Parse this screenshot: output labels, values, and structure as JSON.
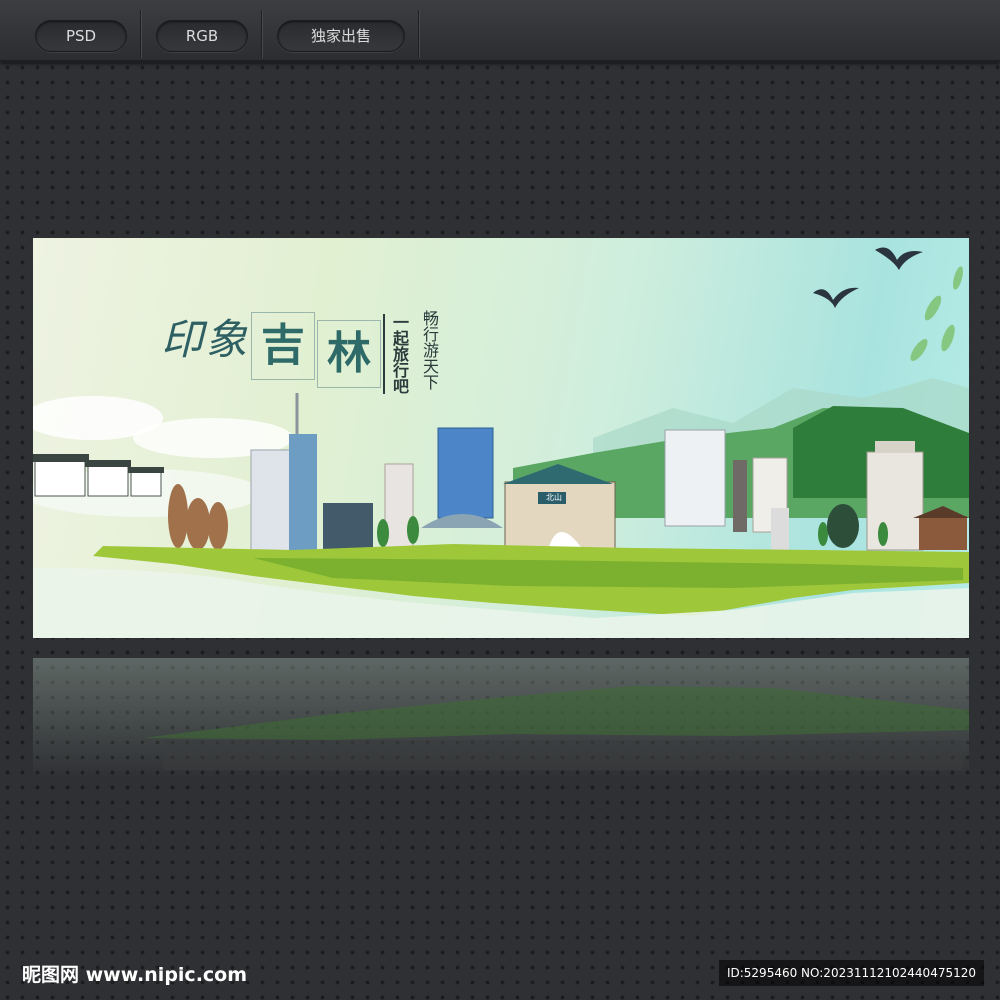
{
  "toolbar": {
    "tabs": [
      {
        "label": "PSD"
      },
      {
        "label": "RGB"
      },
      {
        "label": "独家出售"
      }
    ]
  },
  "banner": {
    "script_title": "印象",
    "main_title": [
      "吉",
      "林"
    ],
    "tagline": "一起旅行吧",
    "slogan": "畅行游天下",
    "gate_plaque": "北山"
  },
  "footer": {
    "logo_text": "昵图网 www.nipic.com",
    "id_text": "ID:5295460 NO:20231112102440475120"
  }
}
